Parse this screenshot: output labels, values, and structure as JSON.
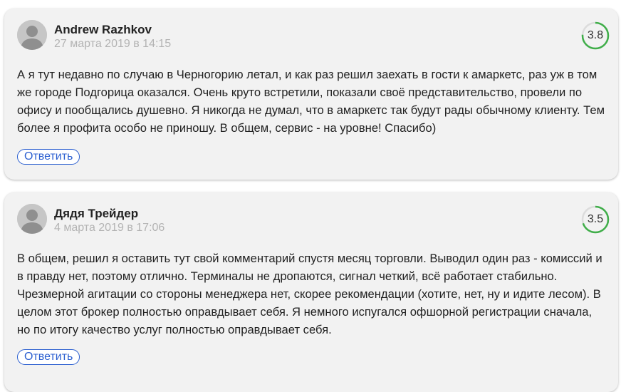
{
  "reviews": [
    {
      "author": "Andrew Razhkov",
      "date": "27 марта 2019 в 14:15",
      "rating": "3.8",
      "rating_fraction": 0.76,
      "text": "А я тут недавно по случаю в Черногорию летал, и как раз решил заехать в гости к амаркетс, раз уж в том же городе Подгорица оказался. Очень круто встретили, показали своё представительство, провели по офису и пообщались душевно. Я никогда не думал, что в амаркетс так будут рады обычному клиенту. Тем более я профита особо не приношу. В общем, сервис - на уровне! Спасибо)",
      "reply_label": "Ответить"
    },
    {
      "author": "Дядя Трейдер",
      "date": "4 марта 2019 в 17:06",
      "rating": "3.5",
      "rating_fraction": 0.7,
      "text": "В общем, решил я оставить тут свой комментарий спустя месяц торговли. Выводил один раз - комиссий и в правду нет, поэтому отлично. Терминалы не дропаются, сигнал четкий, всё работает стабильно. Чрезмерной агитации со стороны менеджера нет, скорее рекомендации (хотите, нет, ну и идите лесом). В целом этот брокер полностью оправдывает себя. Я немного испугался офшорной регистрации сначала, но по итогу качество услуг полностью оправдывает себя.",
      "reply_label": "Ответить"
    }
  ],
  "colors": {
    "card_bg": "#f2f2f2",
    "rating_ring": "#3fae49",
    "rating_track": "#dcdcdc",
    "link_blue": "#2b5fd0",
    "date_gray": "#b3b3b3"
  }
}
